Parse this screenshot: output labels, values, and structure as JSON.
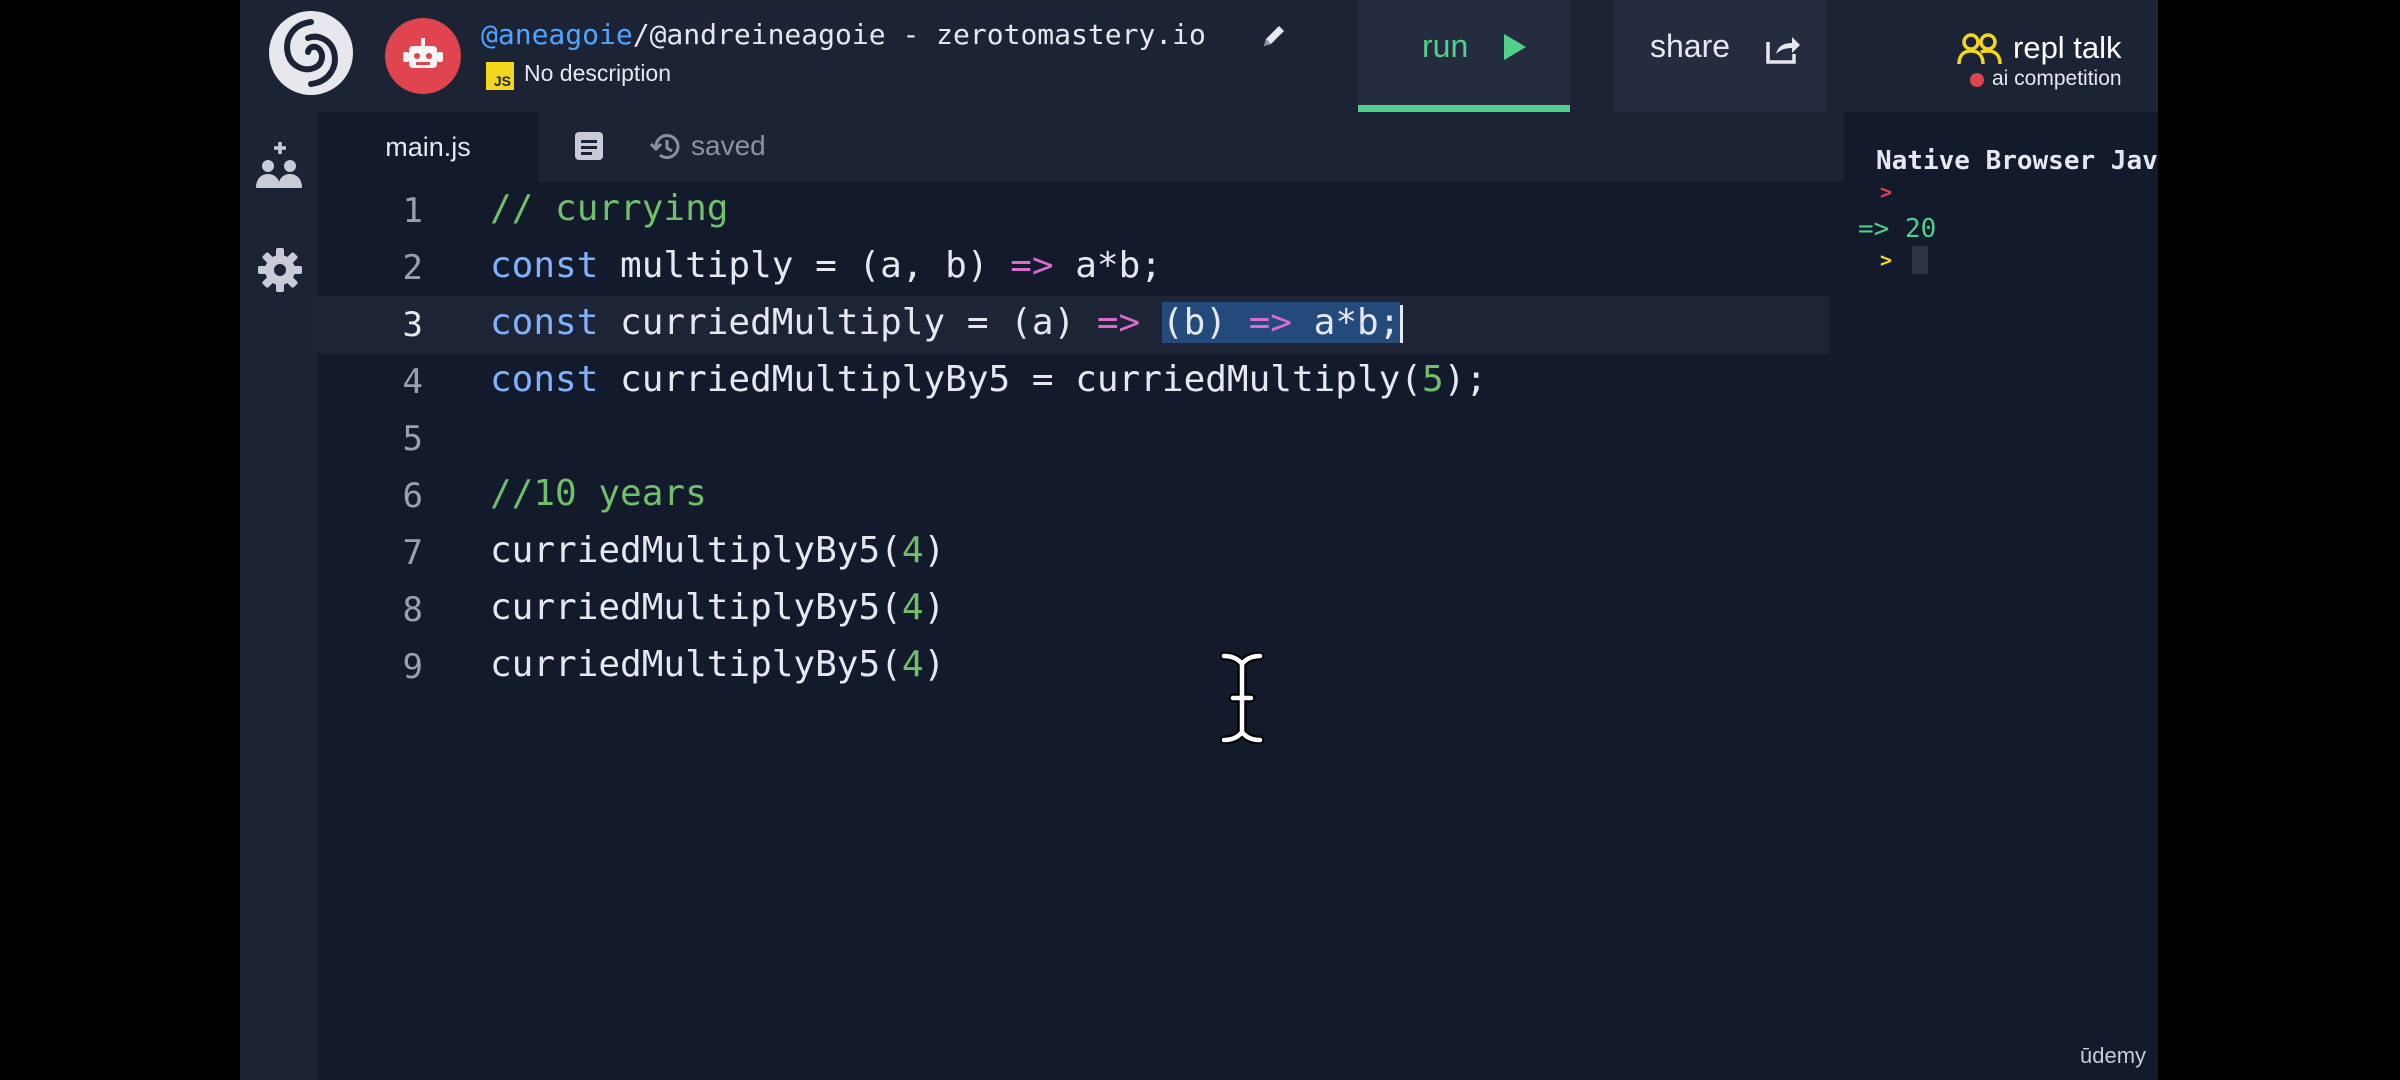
{
  "header": {
    "repl_user": "@aneagoie",
    "repl_slug": "/@andreineagoie - zerotomastery.io",
    "lang_badge": "JS",
    "description": "No description",
    "run_label": "run",
    "share_label": "share",
    "talk_title": "repl talk",
    "talk_subtitle": "ai competition"
  },
  "editor": {
    "tab_label": "main.js",
    "saved_label": "saved",
    "line_numbers": [
      "1",
      "2",
      "3",
      "4",
      "5",
      "6",
      "7",
      "8",
      "9"
    ],
    "lines": {
      "l1": "// currying",
      "l2_kw": "const",
      "l2_a": " multiply = (a, b) ",
      "l2_op": "=>",
      "l2_b": " a*b;",
      "l3_kw": "const",
      "l3_a": " curriedMultiply = (a) ",
      "l3_op1": "=>",
      "l3_sp": " ",
      "l3_sel_a": "(b) ",
      "l3_op2": "=>",
      "l3_sel_b": " a*b;",
      "l4_kw": "const",
      "l4_a": " curriedMultiplyBy5 = curriedMultiply(",
      "l4_num": "5",
      "l4_b": ");",
      "l6": "//10 years",
      "l7_a": "curriedMultiplyBy5(",
      "l7_num": "4",
      "l7_b": ")",
      "l8_a": "curriedMultiplyBy5(",
      "l8_num": "4",
      "l8_b": ")",
      "l9_a": "curriedMultiplyBy5(",
      "l9_num": "4",
      "l9_b": ")"
    }
  },
  "console": {
    "title": "Native Browser JavaScript",
    "result": "=> 20"
  },
  "watermark": "ūdemy",
  "colors": {
    "background": "#131a2b",
    "panel": "#1c2335",
    "accent_green": "#4fd18b",
    "keyword_blue": "#7fb1ff",
    "arrow_pink": "#d86bd0",
    "comment_green": "#6fbf6b",
    "avatar_red": "#e0444e",
    "js_yellow": "#f3d71f"
  },
  "icons": {
    "logo": "replit-swirl-logo",
    "avatar": "robot-avatar",
    "edit": "pencil-icon",
    "run": "play-icon",
    "share": "share-icon",
    "talk": "people-icon",
    "invite": "add-user-icon",
    "settings": "gear-icon",
    "files": "file-icon",
    "history": "history-icon",
    "text_cursor": "ibeam-cursor"
  }
}
